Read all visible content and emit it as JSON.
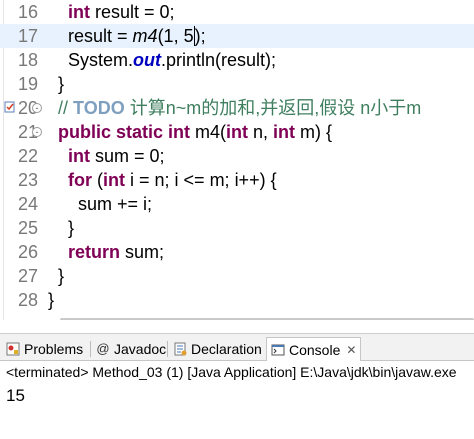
{
  "editor": {
    "lines": [
      {
        "num": "16",
        "parts": [
          {
            "t": "    "
          },
          {
            "t": "int",
            "c": "kw"
          },
          {
            "t": " result = 0;"
          }
        ]
      },
      {
        "num": "17",
        "current": true,
        "parts": [
          {
            "t": "    result = "
          },
          {
            "t": "m4",
            "c": "method-italic"
          },
          {
            "t": "(1, 5"
          },
          {
            "caret": true
          },
          {
            "t": ");"
          }
        ]
      },
      {
        "num": "18",
        "parts": [
          {
            "t": "    System."
          },
          {
            "t": "out",
            "c": "static-field"
          },
          {
            "t": ".println(result);"
          }
        ]
      },
      {
        "num": "19",
        "parts": [
          {
            "t": "  }"
          }
        ]
      },
      {
        "num": "20",
        "fold": "-",
        "task": true,
        "parts": [
          {
            "t": "  "
          },
          {
            "t": "// ",
            "c": "comment"
          },
          {
            "t": "TODO",
            "c": "todo"
          },
          {
            "t": " 计算n~m的加和,并返回,假设 n小于m",
            "c": "comment"
          }
        ]
      },
      {
        "num": "21",
        "fold": "-",
        "parts": [
          {
            "t": "  "
          },
          {
            "t": "public static int",
            "c": "kw"
          },
          {
            "t": " m4("
          },
          {
            "t": "int",
            "c": "kw"
          },
          {
            "t": " n, "
          },
          {
            "t": "int",
            "c": "kw"
          },
          {
            "t": " m) {"
          }
        ]
      },
      {
        "num": "22",
        "parts": [
          {
            "t": "    "
          },
          {
            "t": "int",
            "c": "kw"
          },
          {
            "t": " sum = 0;"
          }
        ]
      },
      {
        "num": "23",
        "parts": [
          {
            "t": "    "
          },
          {
            "t": "for",
            "c": "kw"
          },
          {
            "t": " ("
          },
          {
            "t": "int",
            "c": "kw"
          },
          {
            "t": " i = n; i <= m; i++) {"
          }
        ]
      },
      {
        "num": "24",
        "parts": [
          {
            "t": "      sum += i;"
          }
        ]
      },
      {
        "num": "25",
        "parts": [
          {
            "t": "    }"
          }
        ]
      },
      {
        "num": "26",
        "parts": [
          {
            "t": "    "
          },
          {
            "t": "return",
            "c": "kw"
          },
          {
            "t": " sum;"
          }
        ]
      },
      {
        "num": "27",
        "parts": [
          {
            "t": "  }"
          }
        ]
      },
      {
        "num": "28",
        "parts": [
          {
            "t": "}"
          }
        ]
      }
    ]
  },
  "views": {
    "tabs": [
      {
        "label": "Problems",
        "icon": "problems-icon"
      },
      {
        "label": "Javadoc",
        "icon": "at-sign-icon"
      },
      {
        "label": "Declaration",
        "icon": "declaration-icon"
      },
      {
        "label": "Console",
        "icon": "console-icon",
        "active": true,
        "close": "✕"
      }
    ],
    "console_status": "<terminated> Method_03 (1) [Java Application] E:\\Java\\jdk\\bin\\javaw.exe",
    "console_output": "15"
  },
  "colors": {
    "keyword": "#7f0055",
    "comment": "#3f7f5f",
    "todo": "#7f9fbf",
    "static_field": "#0000c0",
    "current_line": "#e8f2fe",
    "line_number": "#787878"
  }
}
